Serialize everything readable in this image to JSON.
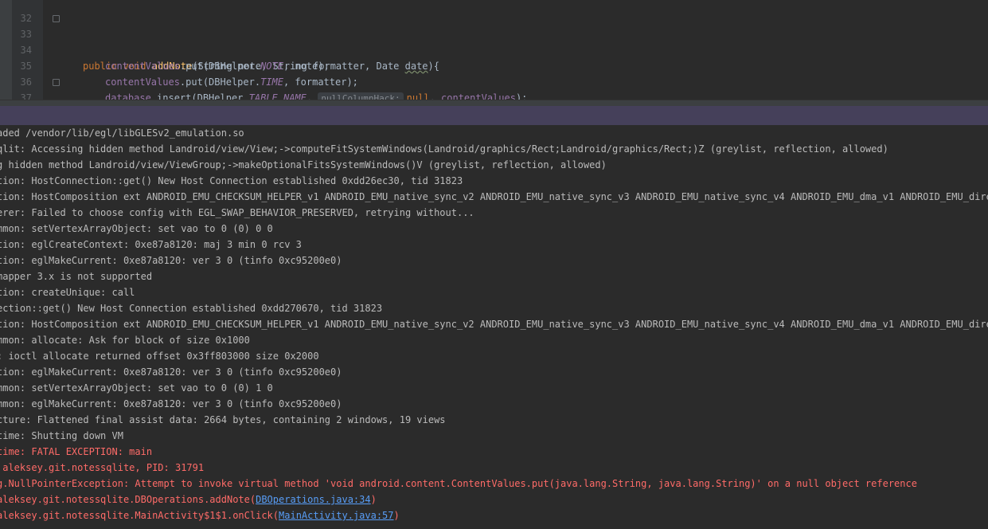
{
  "editor": {
    "lines": [
      {
        "num": "32",
        "code": ""
      },
      {
        "num": "33",
        "kw1": "public",
        "kw2": "void",
        "method": "addNote",
        "sig_rest": "(String note, String formatter, Date ",
        "param_date": "date",
        "sig_end": "){"
      },
      {
        "num": "34",
        "var": "contentValues",
        "mid": ".put(DBHelper.",
        "field": "NOTE",
        "tail": ", note);"
      },
      {
        "num": "35",
        "var": "contentValues",
        "mid": ".put(DBHelper.",
        "field": "TIME",
        "tail": ", formatter);"
      },
      {
        "num": "36",
        "var": "database",
        "mid": ".insert(DBHelper.",
        "field": "TABLE_NAME",
        "comma": ", ",
        "hint": "nullColumnHack:",
        "null_kw": "null",
        "tail_sep": ", ",
        "var2": "contentValues",
        "tail": ");"
      },
      {
        "num": "37",
        "code": "}"
      }
    ]
  },
  "logcat": {
    "lines": [
      {
        "text": "aded /vendor/lib/egl/libGLESv2_emulation.so",
        "error": false
      },
      {
        "text": "qlit: Accessing hidden method Landroid/view/View;->computeFitSystemWindows(Landroid/graphics/Rect;Landroid/graphics/Rect;)Z (greylist, reflection, allowed)",
        "error": false
      },
      {
        "text": "g hidden method Landroid/view/ViewGroup;->makeOptionalFitsSystemWindows()V (greylist, reflection, allowed)",
        "error": false
      },
      {
        "text": "tion: HostConnection::get() New Host Connection established 0xdd26ec30, tid 31823",
        "error": false
      },
      {
        "text": "tion: HostComposition ext ANDROID_EMU_CHECKSUM_HELPER_v1 ANDROID_EMU_native_sync_v2 ANDROID_EMU_native_sync_v3 ANDROID_EMU_native_sync_v4 ANDROID_EMU_dma_v1 ANDROID_EMU_direct_mem",
        "error": false
      },
      {
        "text": "erer: Failed to choose config with EGL_SWAP_BEHAVIOR_PRESERVED, retrying without...",
        "error": false
      },
      {
        "text": "mmon: setVertexArrayObject: set vao to 0 (0) 0 0",
        "error": false
      },
      {
        "text": "tion: eglCreateContext: 0xe87a8120: maj 3 min 0 rcv 3",
        "error": false
      },
      {
        "text": "tion: eglMakeCurrent: 0xe87a8120: ver 3 0 (tinfo 0xc95200e0)",
        "error": false
      },
      {
        "text": "mapper 3.x is not supported",
        "error": false
      },
      {
        "text": "tion: createUnique: call",
        "error": false
      },
      {
        "text": "ection::get() New Host Connection established 0xdd270670, tid 31823",
        "error": false
      },
      {
        "text": "tion: HostComposition ext ANDROID_EMU_CHECKSUM_HELPER_v1 ANDROID_EMU_native_sync_v2 ANDROID_EMU_native_sync_v3 ANDROID_EMU_native_sync_v4 ANDROID_EMU_dma_v1 ANDROID_EMU_direct_mem",
        "error": false
      },
      {
        "text": "mmon: allocate: Ask for block of size 0x1000",
        "error": false
      },
      {
        "text": ": ioctl allocate returned offset 0x3ff803000 size 0x2000",
        "error": false
      },
      {
        "text": "tion: eglMakeCurrent: 0xe87a8120: ver 3 0 (tinfo 0xc95200e0)",
        "error": false
      },
      {
        "text": "mmon: setVertexArrayObject: set vao to 0 (0) 1 0",
        "error": false
      },
      {
        "text": "mmon: eglMakeCurrent: 0xe87a8120: ver 3 0 (tinfo 0xc95200e0)",
        "error": false
      },
      {
        "text": "cture: Flattened final assist data: 2664 bytes, containing 2 windows, 19 views",
        "error": false
      },
      {
        "text": "time: Shutting down VM",
        "error": false
      },
      {
        "text": "time: FATAL EXCEPTION: main",
        "error": true
      },
      {
        "text": " aleksey.git.notessqlite, PID: 31791",
        "error": true
      },
      {
        "text": "g.NullPointerException: Attempt to invoke virtual method 'void android.content.ContentValues.put(java.lang.String, java.lang.String)' on a null object reference",
        "error": true
      },
      {
        "text": "aleksey.git.notessqlite.DBOperations.addNote(",
        "link": "DBOperations.java:34",
        "tail": ")",
        "error": true
      },
      {
        "text": "aleksey.git.notessqlite.MainActivity$1$1.onClick(",
        "link": "MainActivity.java:57",
        "tail": ")",
        "error": true
      }
    ]
  }
}
